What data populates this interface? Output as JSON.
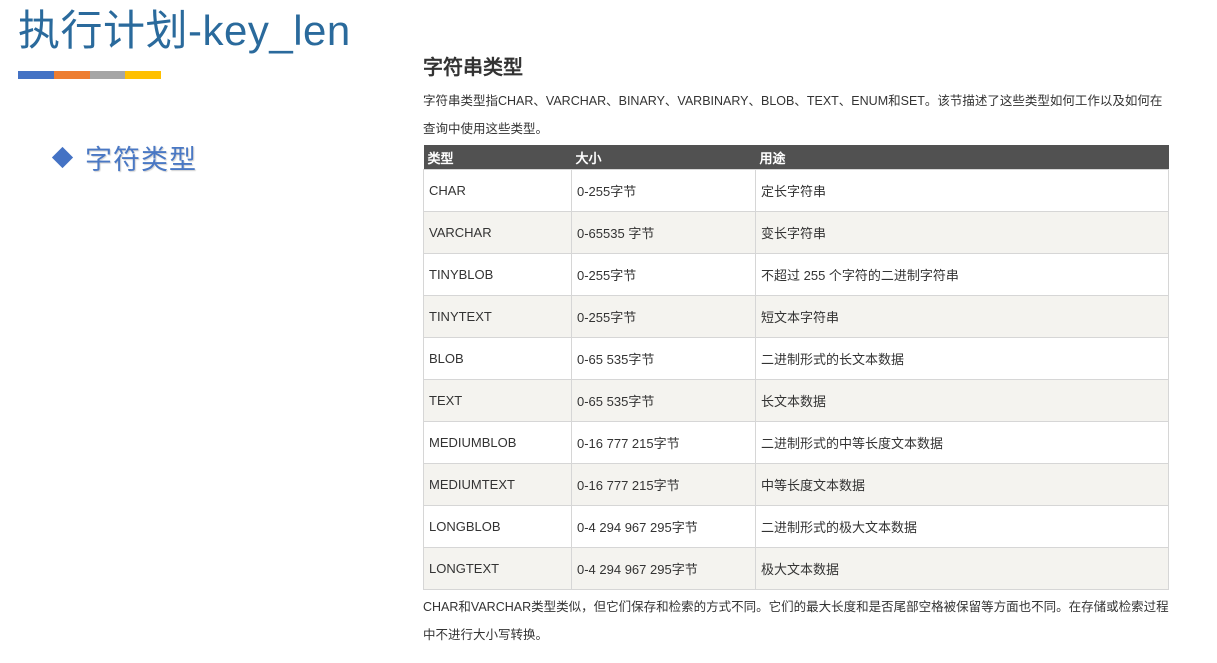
{
  "slide": {
    "title": "执行计划-key_len",
    "accent_colors": [
      "#4472c4",
      "#ed7d31",
      "#a5a5a5",
      "#ffc000"
    ],
    "bullet_text": "字符类型"
  },
  "content": {
    "heading": "字符串类型",
    "description": "字符串类型指CHAR、VARCHAR、BINARY、VARBINARY、BLOB、TEXT、ENUM和SET。该节描述了这些类型如何工作以及如何在查询中使用这些类型。",
    "table": {
      "headers": [
        "类型",
        "大小",
        "用途"
      ],
      "rows": [
        [
          "CHAR",
          "0-255字节",
          "定长字符串"
        ],
        [
          "VARCHAR",
          "0-65535 字节",
          "变长字符串"
        ],
        [
          "TINYBLOB",
          "0-255字节",
          "不超过 255 个字符的二进制字符串"
        ],
        [
          "TINYTEXT",
          "0-255字节",
          "短文本字符串"
        ],
        [
          "BLOB",
          "0-65 535字节",
          "二进制形式的长文本数据"
        ],
        [
          "TEXT",
          "0-65 535字节",
          "长文本数据"
        ],
        [
          "MEDIUMBLOB",
          "0-16 777 215字节",
          "二进制形式的中等长度文本数据"
        ],
        [
          "MEDIUMTEXT",
          "0-16 777 215字节",
          "中等长度文本数据"
        ],
        [
          "LONGBLOB",
          "0-4 294 967 295字节",
          "二进制形式的极大文本数据"
        ],
        [
          "LONGTEXT",
          "0-4 294 967 295字节",
          "极大文本数据"
        ]
      ]
    },
    "footer": "CHAR和VARCHAR类型类似，但它们保存和检索的方式不同。它们的最大长度和是否尾部空格被保留等方面也不同。在存储或检索过程中不进行大小写转换。"
  }
}
